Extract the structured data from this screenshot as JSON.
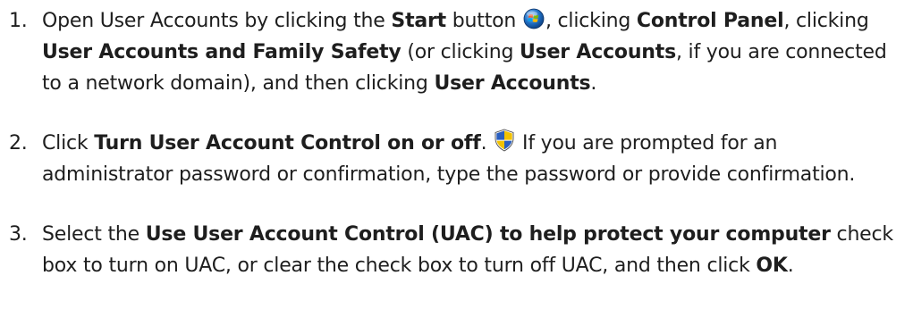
{
  "steps": [
    {
      "number": "1.",
      "p1": "Open User Accounts by clicking the ",
      "b1": "Start",
      "p2": " button ",
      "icon": "windows-start-orb-icon",
      "p3": ", clicking ",
      "b2": "Control Panel",
      "p4": ", clicking ",
      "b3": "User Accounts and Family Safety",
      "p5": " (or clicking ",
      "b4": "User Accounts",
      "p6": ", if you are connected to a network domain), and then clicking ",
      "b5": "User Accounts",
      "p7": "."
    },
    {
      "number": "2.",
      "p1": "Click ",
      "b1": "Turn User Account Control on or off",
      "p2": ". ",
      "icon": "uac-shield-icon",
      "p3": " If you are prompted for an administrator password or confirmation, type the password or provide confirmation."
    },
    {
      "number": "3.",
      "p1": "Select the ",
      "b1": "Use User Account Control (UAC) to help protect your computer",
      "p2": " check box to turn on UAC, or clear the check box to turn off UAC, and then click ",
      "b2": "OK",
      "p3": "."
    }
  ],
  "colors": {
    "text": "#1e1e1e",
    "background": "#ffffff",
    "start_orb_blue": "#1f6fc4",
    "shield_blue": "#2a5fbf",
    "shield_yellow": "#f2c200"
  }
}
